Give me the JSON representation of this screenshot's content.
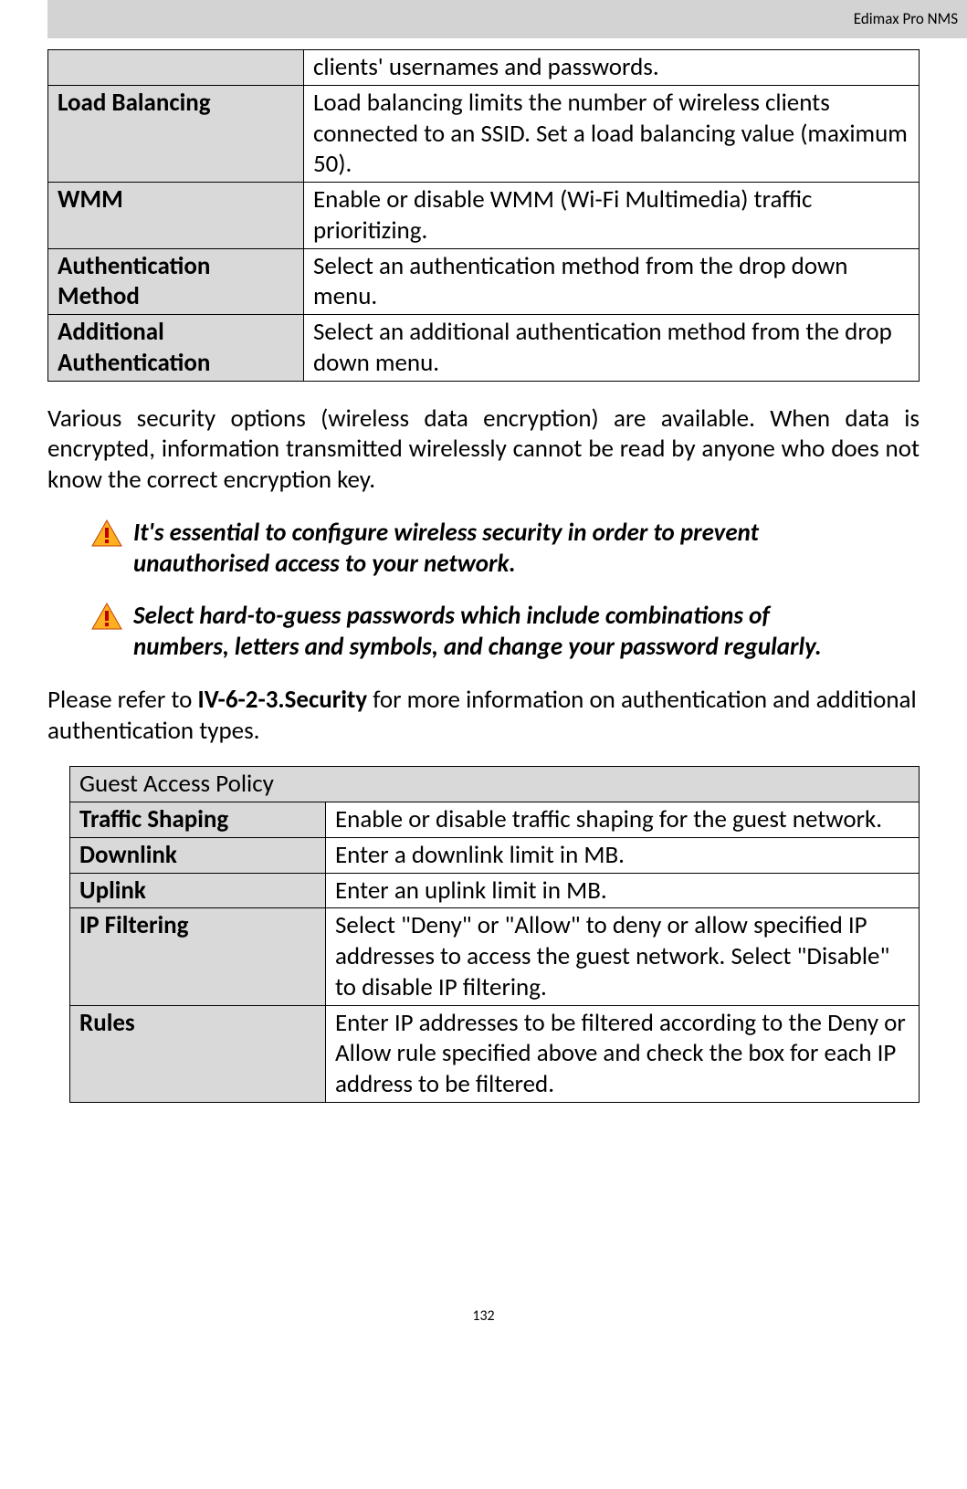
{
  "header": "Edimax Pro NMS",
  "table1": {
    "rows": [
      {
        "term": "",
        "desc": "clients' usernames and passwords."
      },
      {
        "term": "Load Balancing",
        "desc": "Load balancing limits the number of wireless clients connected to an SSID. Set a load balancing value (maximum 50)."
      },
      {
        "term": "WMM",
        "desc": "Enable or disable WMM (Wi-Fi Multimedia) traffic prioritizing."
      },
      {
        "term": "Authentication Method",
        "desc": "Select an authentication method from the drop down menu."
      },
      {
        "term": "Additional Authentication",
        "desc": "Select an additional authentication method from the drop down menu."
      }
    ]
  },
  "para1": "Various security options (wireless data encryption) are available. When data is encrypted, information transmitted wirelessly cannot be read by anyone who does not know the correct encryption key.",
  "warn1": "It's essential to configure wireless security in order to prevent unauthorised access to your network.",
  "warn2": "Select hard-to-guess passwords which include combinations of numbers, letters and symbols, and change your password regularly.",
  "refer_pre": "Please refer to ",
  "refer_bold": "IV-6-2-3.Security",
  "refer_post": " for more information on authentication and additional authentication types.",
  "table2": {
    "title": "Guest Access Policy",
    "rows": [
      {
        "term": "Traffic Shaping",
        "desc": "Enable or disable traffic shaping for the guest network."
      },
      {
        "term": "Downlink",
        "desc": "Enter a downlink limit in MB."
      },
      {
        "term": "Uplink",
        "desc": "Enter an uplink limit in MB."
      },
      {
        "term": "IP Filtering",
        "desc": "Select \"Deny\" or \"Allow\" to deny or allow specified IP addresses to access the guest network. Select \"Disable\" to disable IP filtering."
      },
      {
        "term": "Rules",
        "desc": "Enter IP addresses to be filtered according to the Deny or Allow rule specified above and check the box for each IP address to be filtered."
      }
    ]
  },
  "page_number": "132"
}
